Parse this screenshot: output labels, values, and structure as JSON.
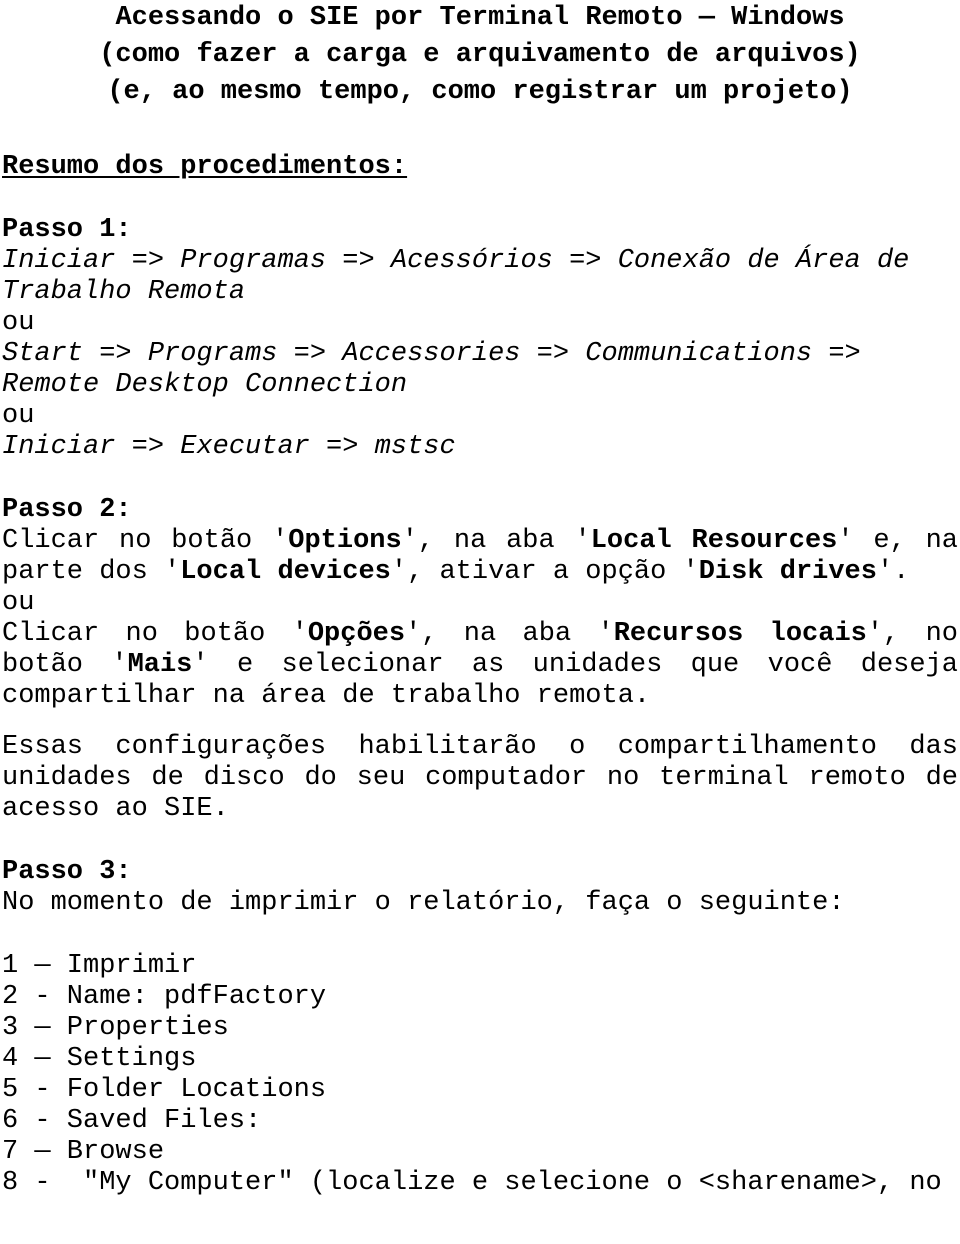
{
  "document": {
    "title_lines": [
      "Acessando o SIE por Terminal Remoto — Windows",
      "(como fazer a carga e arquivamento de arquivos)",
      "(e, ao mesmo tempo, como registrar um projeto)"
    ],
    "summary_heading": "Resumo dos procedimentos:",
    "steps": [
      {
        "label": "Passo 1:",
        "lines": [
          {
            "style": "italic",
            "text": "Iniciar => Programas => Acessórios => Conexão de Área de"
          },
          {
            "style": "italic",
            "text": "Trabalho Remota"
          },
          {
            "style": "plain",
            "text": "ou"
          },
          {
            "style": "italic",
            "text": "Start => Programs => Accessories => Communications =>"
          },
          {
            "style": "italic",
            "text": "Remote Desktop Connection"
          },
          {
            "style": "plain",
            "text": "ou"
          },
          {
            "style": "italic",
            "text": "Iniciar => Executar => mstsc"
          }
        ]
      },
      {
        "label": "Passo 2:",
        "para_a_line1_pre": "Clicar no botão '",
        "para_a_bold1": "Options",
        "para_a_mid1": "', na aba '",
        "para_a_bold2": "Local Resources",
        "para_a_mid2": "' e, na parte dos '",
        "para_a_bold3": "Local devices",
        "para_a_mid3": "', ativar a opção '",
        "para_a_bold4": "Disk drives",
        "para_a_end": "'.",
        "or_label": "ou",
        "para_b_pre": "Clicar no botão '",
        "para_b_bold1": "Opções",
        "para_b_mid1": "', na aba '",
        "para_b_bold2": "Recursos locais",
        "para_b_mid2": "', no botão '",
        "para_b_bold3": "Mais",
        "para_b_end": "' e selecionar as unidades que você deseja compartilhar na área de trabalho remota.",
        "note": "Essas configurações habilitarão o compartilhamento das unidades de disco do seu computador no terminal remoto de acesso ao SIE."
      },
      {
        "label": "Passo 3:",
        "intro": "No momento de imprimir o relatório, faça o seguinte:",
        "items": [
          "1 — Imprimir",
          "2 - Name: pdfFactory",
          "3 — Properties",
          "4 — Settings",
          "5 - Folder Locations",
          "6 - Saved Files:",
          "7 — Browse",
          "8 -  \"My Computer\" (localize e selecione o <sharename>, no"
        ]
      }
    ]
  }
}
